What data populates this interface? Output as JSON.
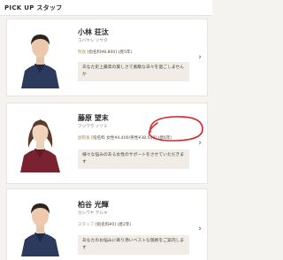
{
  "header": {
    "title": "PICK UP スタッフ"
  },
  "staff": [
    {
      "name": "小林 荘汰",
      "kana": "コバヤシ ソウタ",
      "role": "院長",
      "rate": "[指名料¥8,800]",
      "years": "(歴5年)",
      "description": "あなた史上最高の美しさで素敵な日々を過ごしませんか"
    },
    {
      "name": "藤原 望末",
      "kana": "フジワラ ノゾミ",
      "role": "副院長",
      "rate": "[指名料 女性¥4,400/男性¥38,500]",
      "years": "(歴6年)",
      "description": "様々な悩みのある女性のサポートをさせていただきます"
    },
    {
      "name": "柏谷 光輝",
      "kana": "カシワヤ テルキ",
      "role": "スタッフ",
      "rate": "[指名料¥0]",
      "years": "(歴2年)",
      "description": "あなたのお悩みに寄り添いベストな施術をご案内します"
    }
  ],
  "colors": {
    "background": "#f5f3ef",
    "accent": "#b08a52",
    "annotation": "#d9232e",
    "scrub_navy": "#2c3a5e",
    "scrub_wine": "#7a2230"
  },
  "icons": {
    "chevron": "chevron-right-icon"
  }
}
